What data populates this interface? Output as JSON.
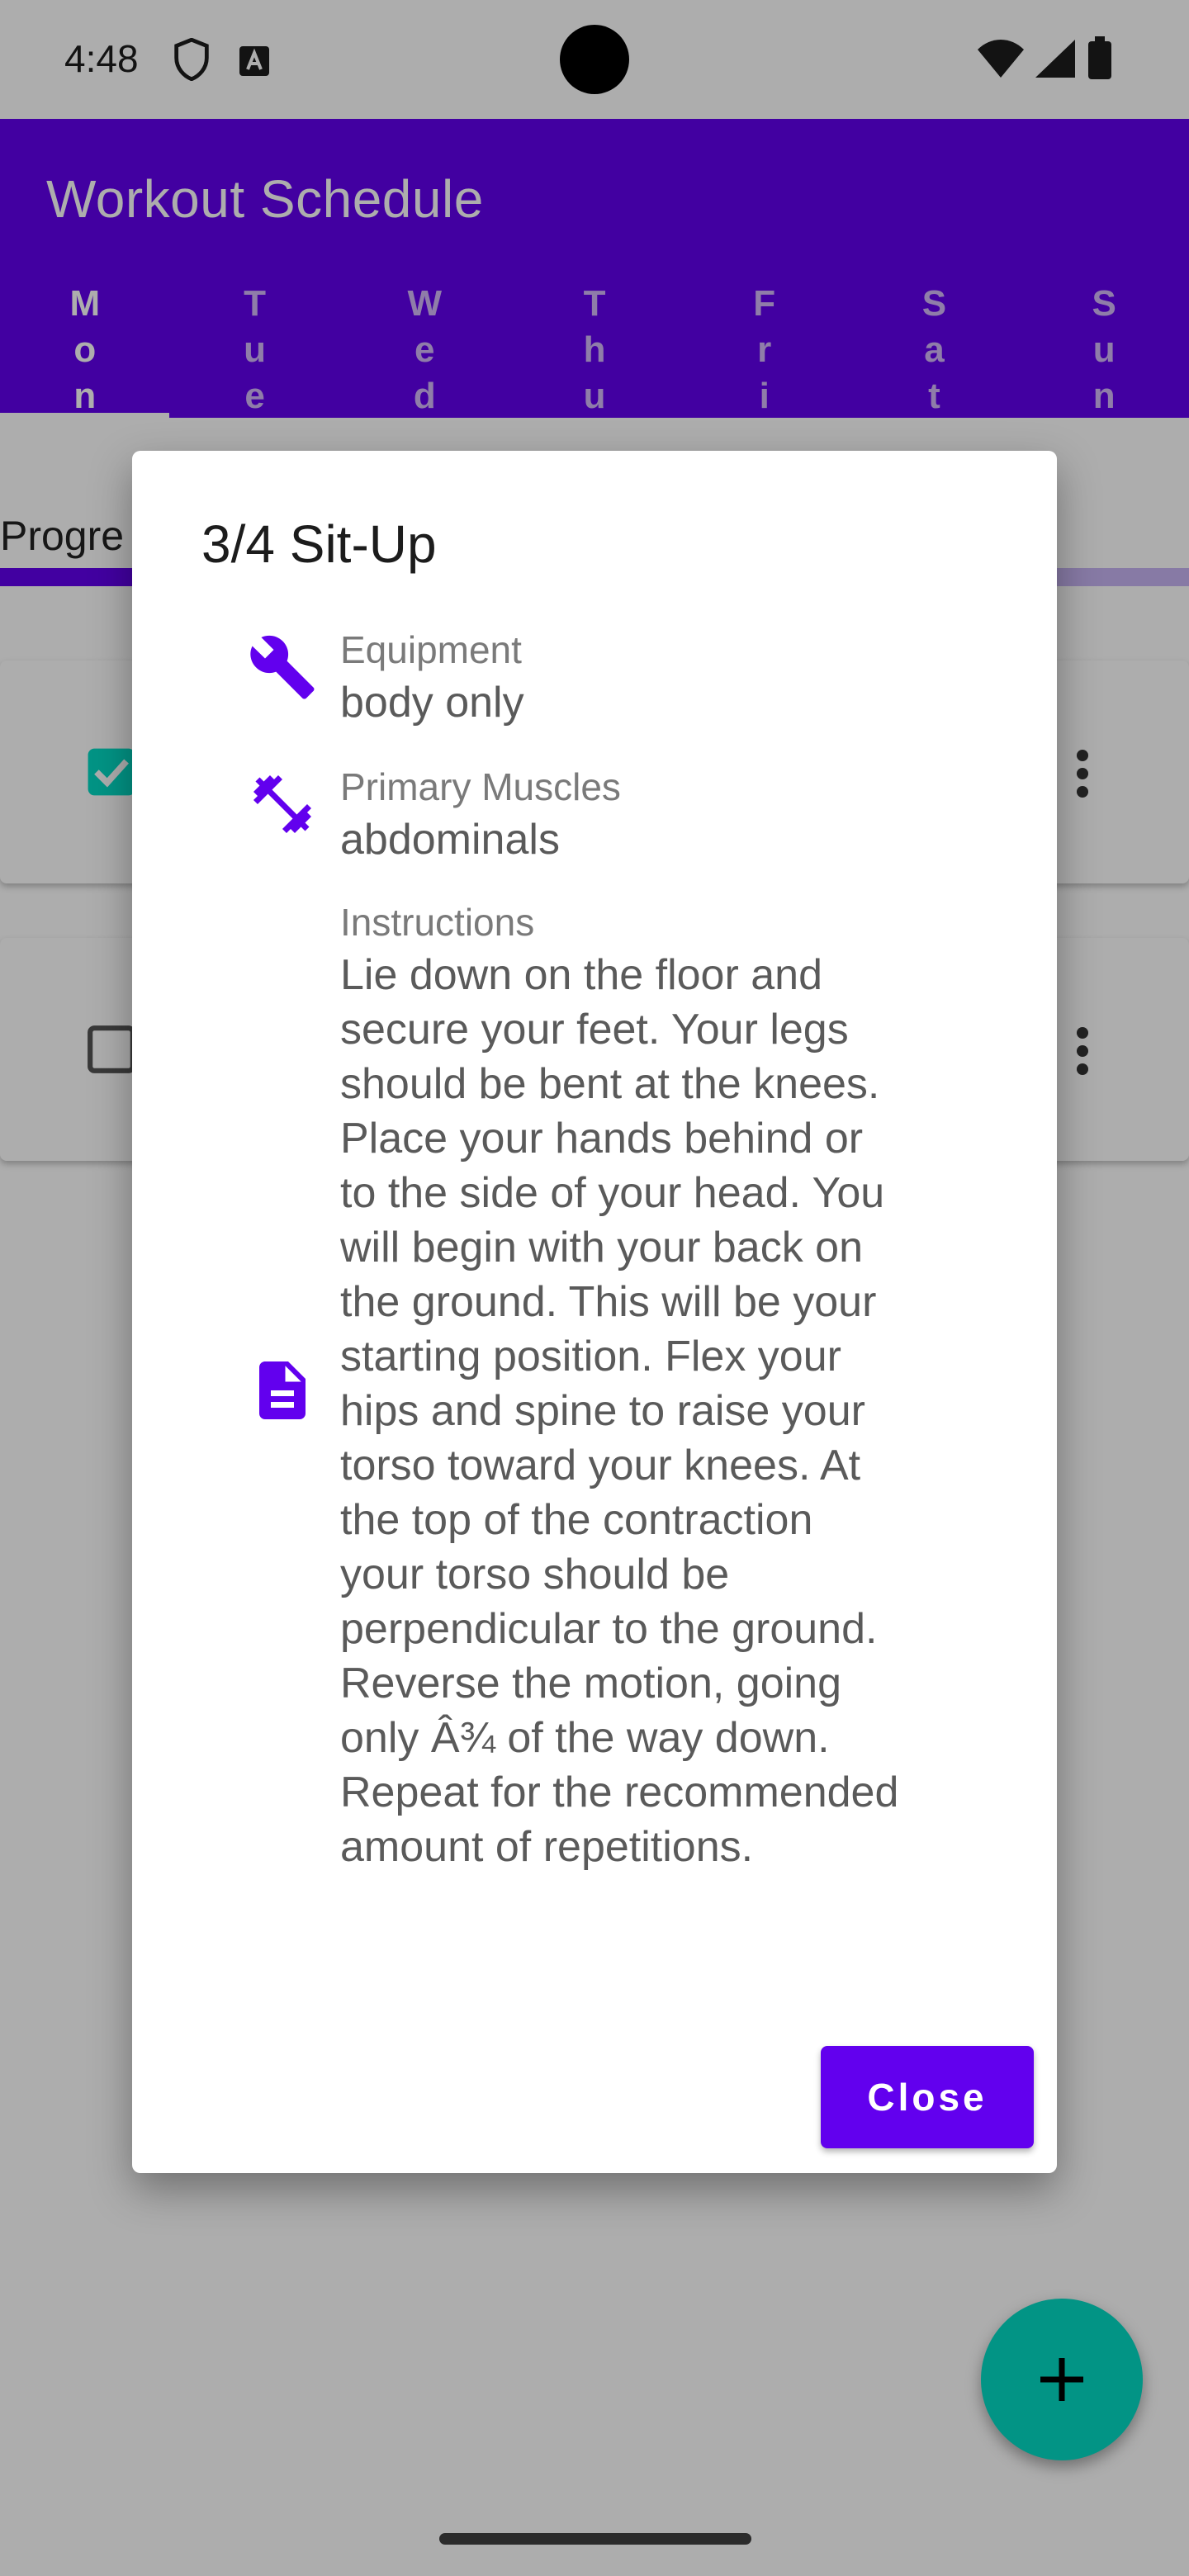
{
  "status_bar": {
    "time": "4:48"
  },
  "app_bar": {
    "title": "Workout Schedule",
    "tabs": [
      {
        "label": [
          "M",
          "o",
          "n"
        ],
        "active": true
      },
      {
        "label": [
          "T",
          "u",
          "e"
        ],
        "active": false
      },
      {
        "label": [
          "W",
          "e",
          "d"
        ],
        "active": false
      },
      {
        "label": [
          "T",
          "h",
          "u"
        ],
        "active": false
      },
      {
        "label": [
          "F",
          "r",
          "i"
        ],
        "active": false
      },
      {
        "label": [
          "S",
          "a",
          "t"
        ],
        "active": false
      },
      {
        "label": [
          "S",
          "u",
          "n"
        ],
        "active": false
      }
    ]
  },
  "progress": {
    "label": "Progre"
  },
  "exercise_cards": [
    {
      "checked": true
    },
    {
      "checked": false
    }
  ],
  "dialog": {
    "title": "3/4 Sit-Up",
    "equipment": {
      "label": "Equipment",
      "value": "body only",
      "icon": "wrench-icon"
    },
    "muscles": {
      "label": "Primary Muscles",
      "value": "abdominals",
      "icon": "dumbbell-icon"
    },
    "instructions": {
      "label": "Instructions",
      "icon": "document-icon",
      "lines": [
        "Lie down on the floor and",
        "secure your feet. Your legs",
        "should be bent at the knees.",
        "Place your hands behind or",
        "to the side of your head. You",
        "will begin with your back on",
        "the ground. This will be your",
        "starting position. Flex your",
        "hips and spine to raise your",
        "torso toward your knees. At",
        "the top of the contraction",
        "your torso should be",
        "perpendicular to the ground.",
        "Reverse the motion, going",
        "only Â¾ of the way down.",
        "Repeat for the recommended",
        "amount of repetitions."
      ]
    },
    "close_label": "Close"
  },
  "fab_icon": "plus-icon",
  "colors": {
    "primary": "#6200ee",
    "secondary": "#03dac5",
    "scrim": "rgba(0,0,0,0.32)"
  }
}
